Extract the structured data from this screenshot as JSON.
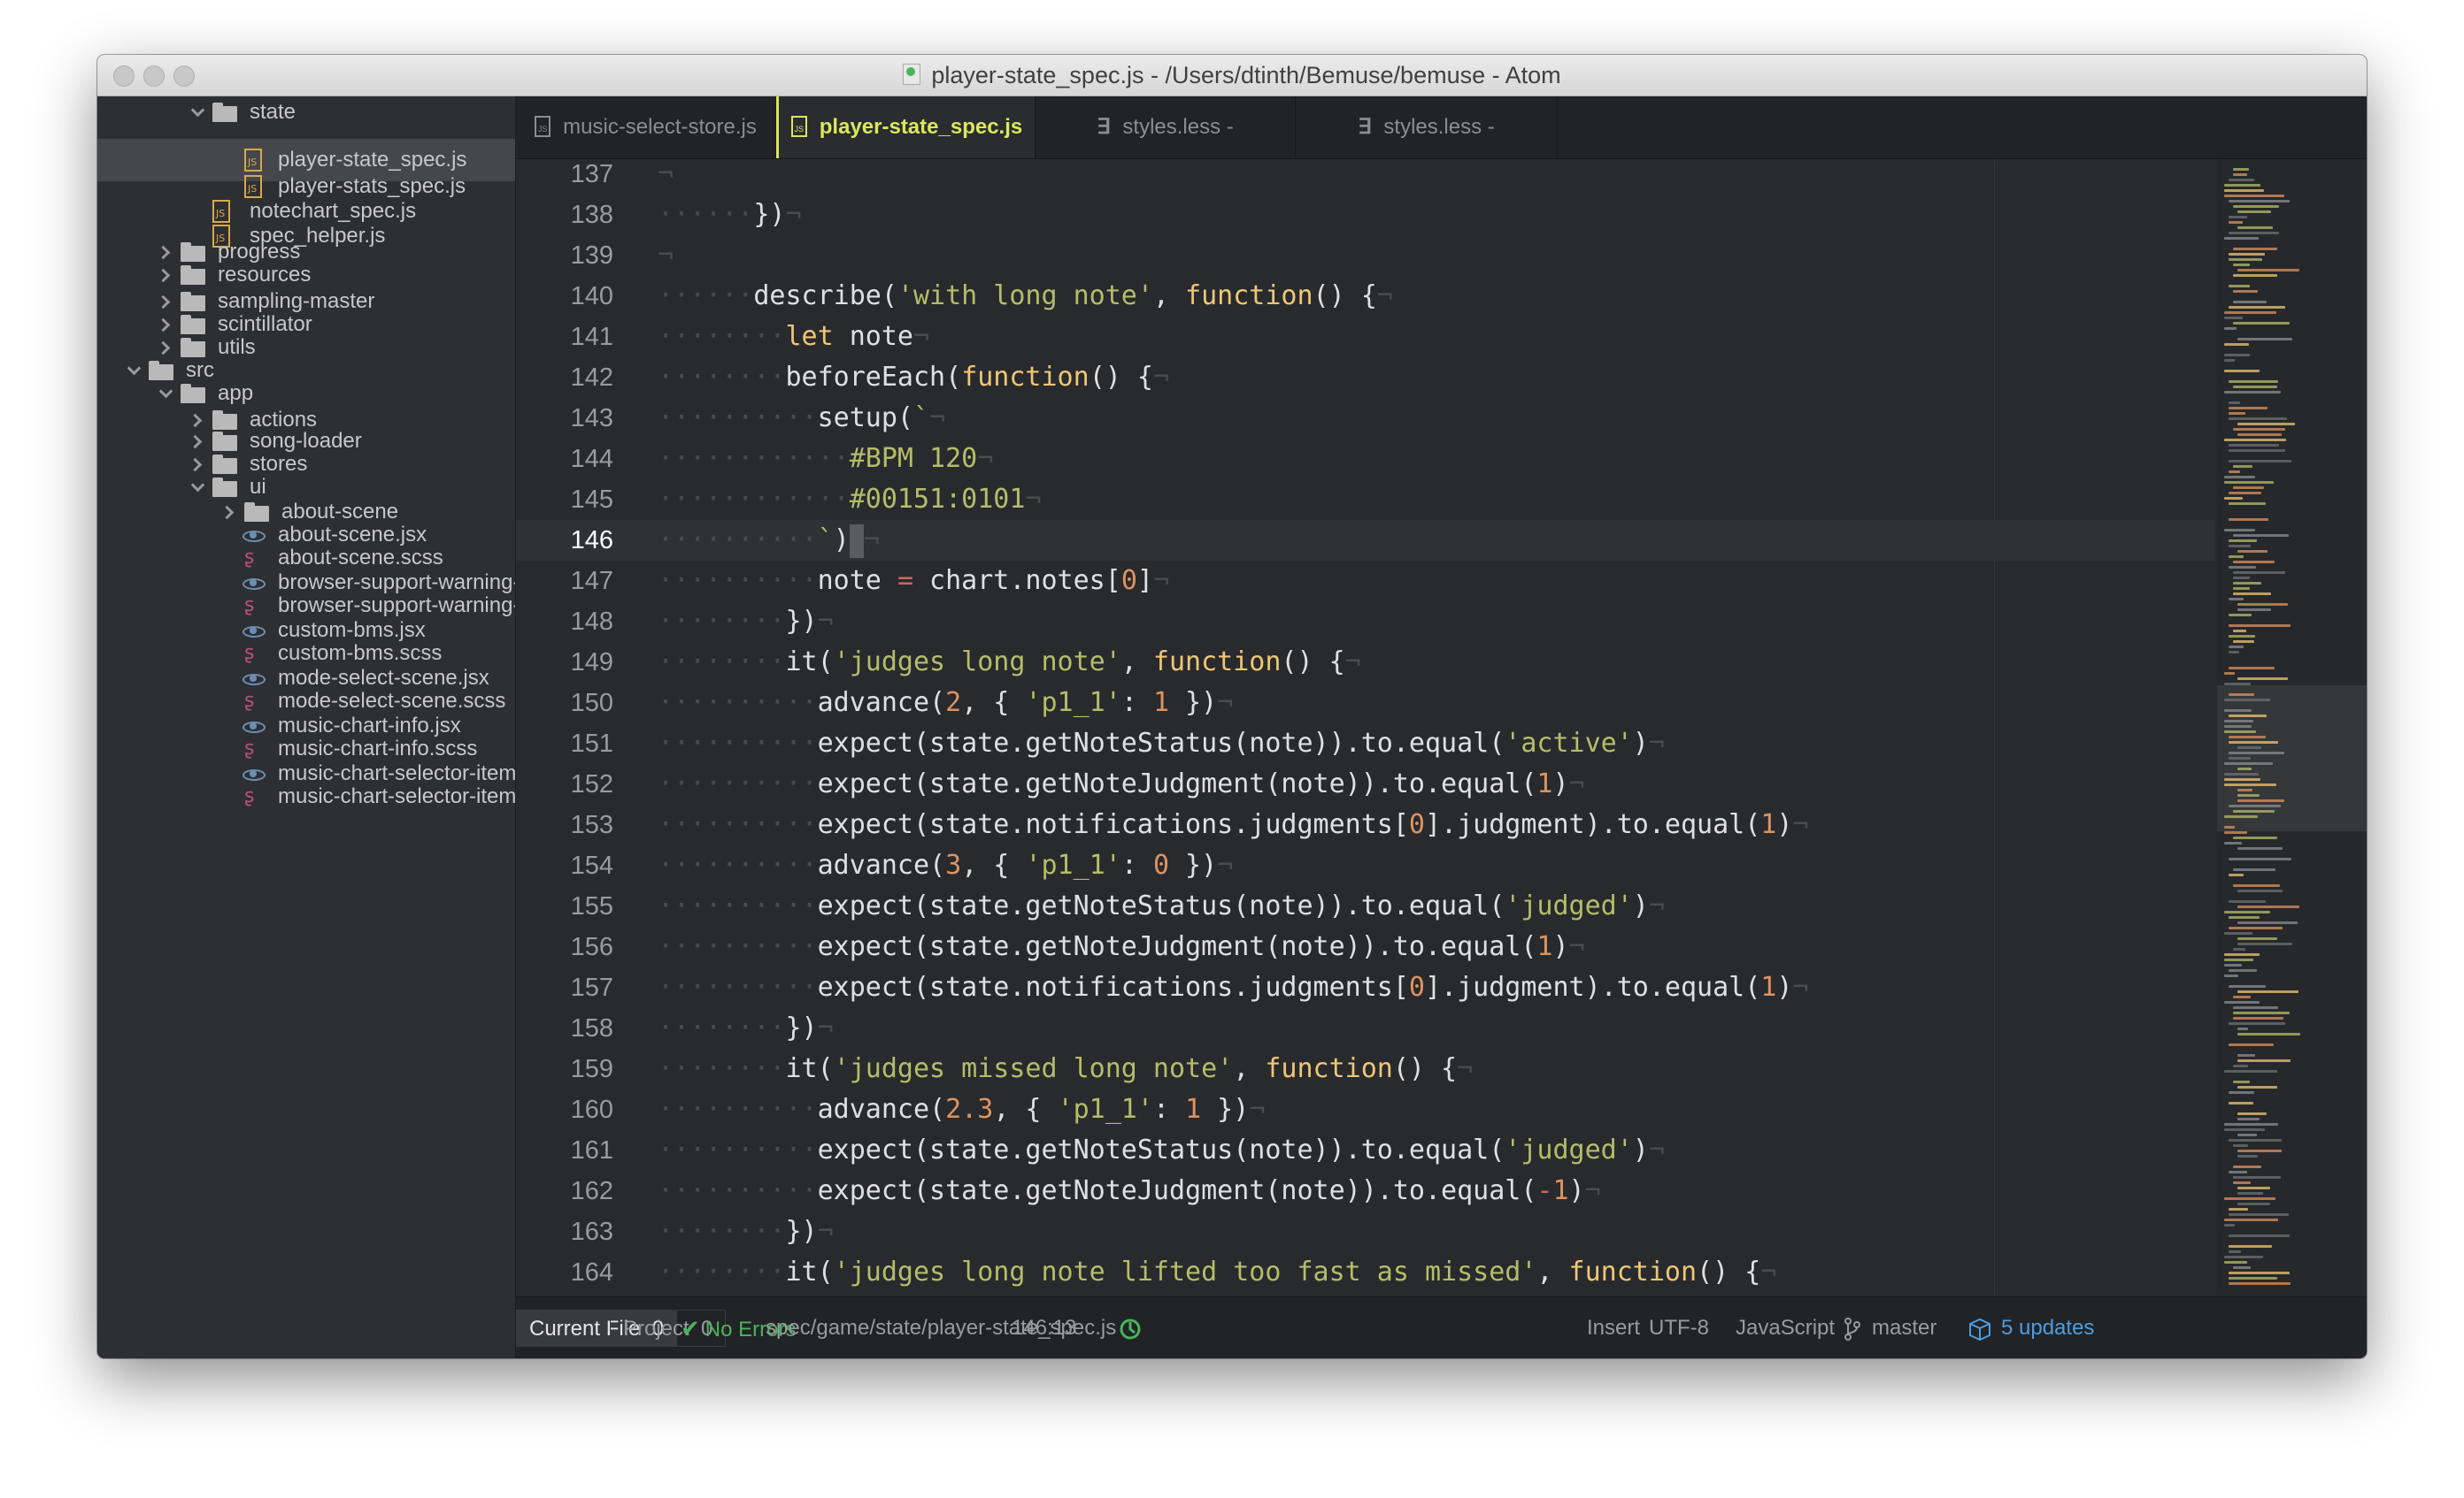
{
  "window": {
    "title": "player-state_spec.js - /Users/dtinth/Bemuse/bemuse - Atom"
  },
  "tree": [
    {
      "label": "state",
      "type": "folder",
      "expanded": true,
      "depth": 3
    },
    {
      "label": "player-state_spec.js",
      "type": "js",
      "depth": 4,
      "selected": true
    },
    {
      "label": "player-stats_spec.js",
      "type": "js",
      "depth": 4
    },
    {
      "label": "notechart_spec.js",
      "type": "js",
      "depth": 3
    },
    {
      "label": "spec_helper.js",
      "type": "js",
      "depth": 3
    },
    {
      "label": "progress",
      "type": "folder",
      "expanded": false,
      "depth": 2
    },
    {
      "label": "resources",
      "type": "folder",
      "expanded": false,
      "depth": 2
    },
    {
      "label": "sampling-master",
      "type": "folder",
      "expanded": false,
      "depth": 2
    },
    {
      "label": "scintillator",
      "type": "folder",
      "expanded": false,
      "depth": 2
    },
    {
      "label": "utils",
      "type": "folder",
      "expanded": false,
      "depth": 2
    },
    {
      "label": "src",
      "type": "folder",
      "expanded": true,
      "depth": 1
    },
    {
      "label": "app",
      "type": "folder",
      "expanded": true,
      "depth": 2
    },
    {
      "label": "actions",
      "type": "folder",
      "expanded": false,
      "depth": 3
    },
    {
      "label": "song-loader",
      "type": "folder",
      "expanded": false,
      "depth": 3
    },
    {
      "label": "stores",
      "type": "folder",
      "expanded": false,
      "depth": 3
    },
    {
      "label": "ui",
      "type": "folder",
      "expanded": true,
      "depth": 3
    },
    {
      "label": "about-scene",
      "type": "folder",
      "expanded": false,
      "depth": 4
    },
    {
      "label": "about-scene.jsx",
      "type": "jsx",
      "depth": 4
    },
    {
      "label": "about-scene.scss",
      "type": "scss",
      "depth": 4
    },
    {
      "label": "browser-support-warning-scene.jsx",
      "type": "jsx",
      "depth": 4
    },
    {
      "label": "browser-support-warning-scene.scss",
      "type": "scss",
      "depth": 4
    },
    {
      "label": "custom-bms.jsx",
      "type": "jsx",
      "depth": 4
    },
    {
      "label": "custom-bms.scss",
      "type": "scss",
      "depth": 4
    },
    {
      "label": "mode-select-scene.jsx",
      "type": "jsx",
      "depth": 4
    },
    {
      "label": "mode-select-scene.scss",
      "type": "scss",
      "depth": 4
    },
    {
      "label": "music-chart-info.jsx",
      "type": "jsx",
      "depth": 4
    },
    {
      "label": "music-chart-info.scss",
      "type": "scss",
      "depth": 4
    },
    {
      "label": "music-chart-selector-item.jsx",
      "type": "jsx",
      "depth": 4
    },
    {
      "label": "music-chart-selector-item.scss",
      "type": "scss",
      "depth": 4
    }
  ],
  "tabs": [
    {
      "label": "music-select-store.js",
      "icon": "js",
      "active": false
    },
    {
      "label": "player-state_spec.js",
      "icon": "js",
      "active": true
    },
    {
      "label": "styles.less - /Users/dtinth/.atom",
      "icon": "less",
      "active": false
    },
    {
      "label": "styles.less - /Users/dtinth/.atom",
      "icon": "less",
      "active": false
    }
  ],
  "editor": {
    "cursor_line": 146,
    "lines": [
      {
        "n": "137",
        "indent": 0,
        "tokens": []
      },
      {
        "n": "138",
        "indent": 6,
        "tokens": [
          [
            "p",
            "})"
          ]
        ]
      },
      {
        "n": "139",
        "indent": 0,
        "tokens": []
      },
      {
        "n": "140",
        "indent": 6,
        "tokens": [
          [
            "p",
            "describe("
          ],
          [
            "s",
            "'with long note'"
          ],
          [
            "p",
            ", "
          ],
          [
            "k",
            "function"
          ],
          [
            "p",
            "() {"
          ]
        ]
      },
      {
        "n": "141",
        "indent": 8,
        "tokens": [
          [
            "k",
            "let"
          ],
          [
            "p",
            " note"
          ]
        ]
      },
      {
        "n": "142",
        "indent": 8,
        "tokens": [
          [
            "p",
            "beforeEach("
          ],
          [
            "k",
            "function"
          ],
          [
            "p",
            "() {"
          ]
        ]
      },
      {
        "n": "143",
        "indent": 10,
        "tokens": [
          [
            "p",
            "setup("
          ],
          [
            "s",
            "`"
          ]
        ]
      },
      {
        "n": "144",
        "indent": 12,
        "tokens": [
          [
            "s",
            "#BPM 120"
          ]
        ]
      },
      {
        "n": "145",
        "indent": 12,
        "tokens": [
          [
            "s",
            "#00151:0101"
          ]
        ]
      },
      {
        "n": "146",
        "indent": 10,
        "tokens": [
          [
            "s",
            "`"
          ],
          [
            "p",
            ")"
          ]
        ]
      },
      {
        "n": "147",
        "indent": 10,
        "tokens": [
          [
            "p",
            "note "
          ],
          [
            "o",
            "="
          ],
          [
            "p",
            " chart.notes["
          ],
          [
            "m",
            "0"
          ],
          [
            "p",
            "]"
          ]
        ]
      },
      {
        "n": "148",
        "indent": 8,
        "tokens": [
          [
            "p",
            "})"
          ]
        ]
      },
      {
        "n": "149",
        "indent": 8,
        "tokens": [
          [
            "p",
            "it("
          ],
          [
            "s",
            "'judges long note'"
          ],
          [
            "p",
            ", "
          ],
          [
            "k",
            "function"
          ],
          [
            "p",
            "() {"
          ]
        ]
      },
      {
        "n": "150",
        "indent": 10,
        "tokens": [
          [
            "p",
            "advance("
          ],
          [
            "m",
            "2"
          ],
          [
            "p",
            ", { "
          ],
          [
            "s",
            "'p1_1'"
          ],
          [
            "p",
            ": "
          ],
          [
            "m",
            "1"
          ],
          [
            "p",
            " })"
          ]
        ]
      },
      {
        "n": "151",
        "indent": 10,
        "tokens": [
          [
            "p",
            "expect(state.getNoteStatus(note)).to.equal("
          ],
          [
            "s",
            "'active'"
          ],
          [
            "p",
            ")"
          ]
        ]
      },
      {
        "n": "152",
        "indent": 10,
        "tokens": [
          [
            "p",
            "expect(state.getNoteJudgment(note)).to.equal("
          ],
          [
            "m",
            "1"
          ],
          [
            "p",
            ")"
          ]
        ]
      },
      {
        "n": "153",
        "indent": 10,
        "tokens": [
          [
            "p",
            "expect(state.notifications.judgments["
          ],
          [
            "m",
            "0"
          ],
          [
            "p",
            "].judgment).to.equal("
          ],
          [
            "m",
            "1"
          ],
          [
            "p",
            ")"
          ]
        ]
      },
      {
        "n": "154",
        "indent": 10,
        "tokens": [
          [
            "p",
            "advance("
          ],
          [
            "m",
            "3"
          ],
          [
            "p",
            ", { "
          ],
          [
            "s",
            "'p1_1'"
          ],
          [
            "p",
            ": "
          ],
          [
            "m",
            "0"
          ],
          [
            "p",
            " })"
          ]
        ]
      },
      {
        "n": "155",
        "indent": 10,
        "tokens": [
          [
            "p",
            "expect(state.getNoteStatus(note)).to.equal("
          ],
          [
            "s",
            "'judged'"
          ],
          [
            "p",
            ")"
          ]
        ]
      },
      {
        "n": "156",
        "indent": 10,
        "tokens": [
          [
            "p",
            "expect(state.getNoteJudgment(note)).to.equal("
          ],
          [
            "m",
            "1"
          ],
          [
            "p",
            ")"
          ]
        ]
      },
      {
        "n": "157",
        "indent": 10,
        "tokens": [
          [
            "p",
            "expect(state.notifications.judgments["
          ],
          [
            "m",
            "0"
          ],
          [
            "p",
            "].judgment).to.equal("
          ],
          [
            "m",
            "1"
          ],
          [
            "p",
            ")"
          ]
        ]
      },
      {
        "n": "158",
        "indent": 8,
        "tokens": [
          [
            "p",
            "})"
          ]
        ]
      },
      {
        "n": "159",
        "indent": 8,
        "tokens": [
          [
            "p",
            "it("
          ],
          [
            "s",
            "'judges missed long note'"
          ],
          [
            "p",
            ", "
          ],
          [
            "k",
            "function"
          ],
          [
            "p",
            "() {"
          ]
        ]
      },
      {
        "n": "160",
        "indent": 10,
        "tokens": [
          [
            "p",
            "advance("
          ],
          [
            "m",
            "2.3"
          ],
          [
            "p",
            ", { "
          ],
          [
            "s",
            "'p1_1'"
          ],
          [
            "p",
            ": "
          ],
          [
            "m",
            "1"
          ],
          [
            "p",
            " })"
          ]
        ]
      },
      {
        "n": "161",
        "indent": 10,
        "tokens": [
          [
            "p",
            "expect(state.getNoteStatus(note)).to.equal("
          ],
          [
            "s",
            "'judged'"
          ],
          [
            "p",
            ")"
          ]
        ]
      },
      {
        "n": "162",
        "indent": 10,
        "tokens": [
          [
            "p",
            "expect(state.getNoteJudgment(note)).to.equal("
          ],
          [
            "o",
            "-"
          ],
          [
            "m",
            "1"
          ],
          [
            "p",
            ")"
          ]
        ]
      },
      {
        "n": "163",
        "indent": 8,
        "tokens": [
          [
            "p",
            "})"
          ]
        ]
      },
      {
        "n": "164",
        "indent": 8,
        "tokens": [
          [
            "p",
            "it("
          ],
          [
            "s",
            "'judges long note lifted too fast as missed'"
          ],
          [
            "p",
            ", "
          ],
          [
            "k",
            "function"
          ],
          [
            "p",
            "() {"
          ]
        ]
      }
    ]
  },
  "statusbar": {
    "current_file": "Current File",
    "current_file_count": "0",
    "project": "Project",
    "project_count": "0",
    "no_errors": "No Errors",
    "path": "spec/game/state/player-state_spec.js",
    "cursor_pos": "146:13",
    "mode": "Insert",
    "encoding": "UTF-8",
    "grammar": "JavaScript",
    "branch": "master",
    "updates": "5 updates"
  },
  "colors": {
    "string": "#b5bd68",
    "keyword": "#f0c674",
    "number": "#de935f",
    "operator": "#cc6666",
    "active_tab": "#d9e85c",
    "updates": "#4d9de0",
    "ok": "#49b45a"
  }
}
